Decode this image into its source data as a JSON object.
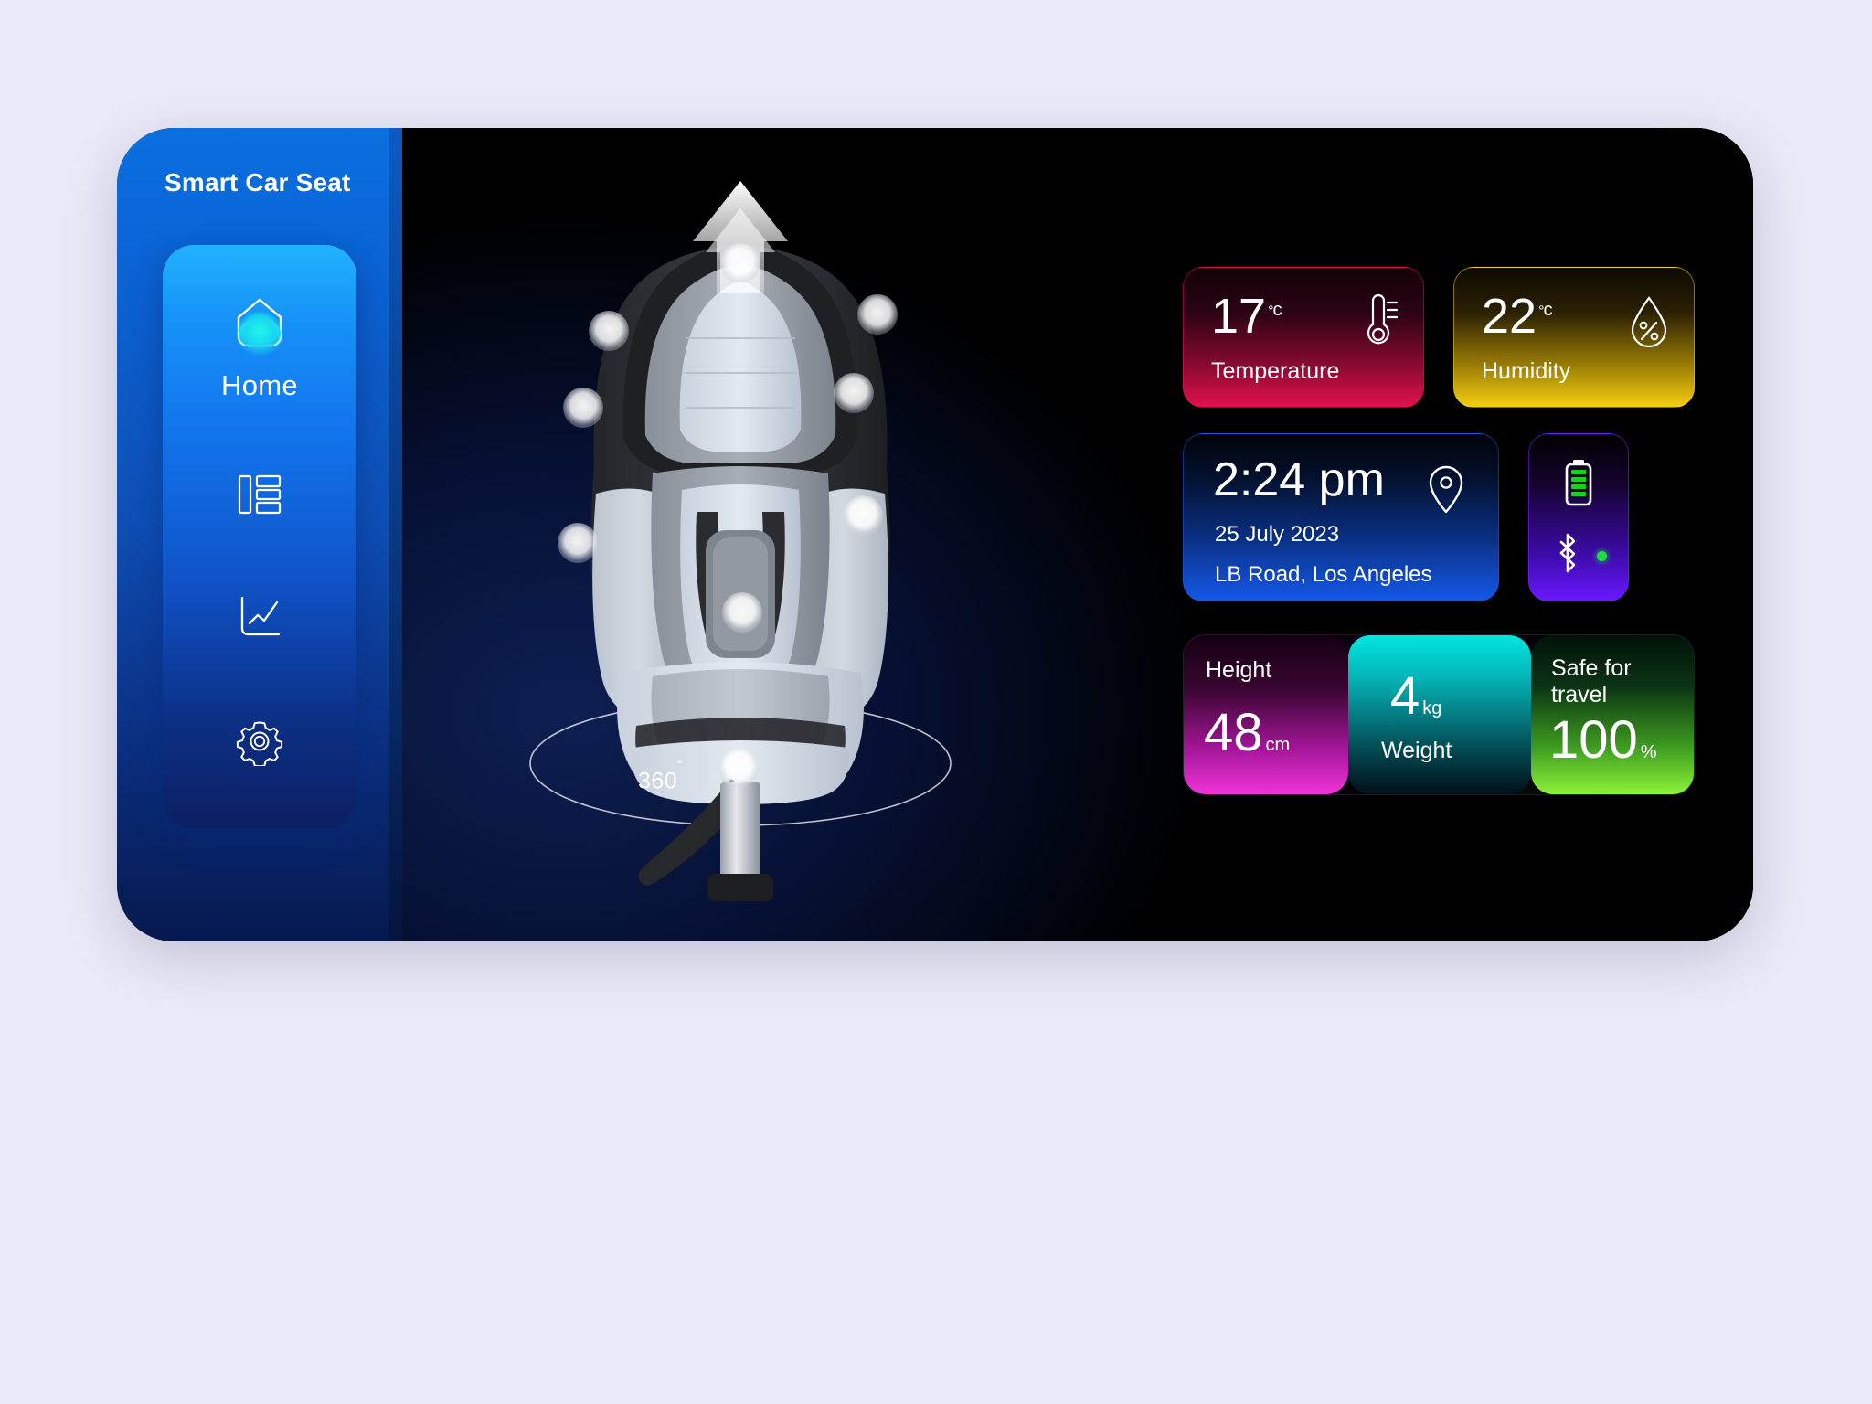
{
  "app": {
    "title": "Smart Car Seat"
  },
  "sidebar": {
    "items": [
      {
        "id": "home",
        "label": "Home",
        "icon": "home-icon",
        "active": true
      },
      {
        "id": "dashboard",
        "label": "",
        "icon": "dashboard-icon",
        "active": false
      },
      {
        "id": "stats",
        "label": "",
        "icon": "line-chart-icon",
        "active": false
      },
      {
        "id": "settings",
        "label": "",
        "icon": "gear-icon",
        "active": false
      }
    ]
  },
  "stage": {
    "rotation_label": "360",
    "rotation_degree_symbol": "°",
    "product": "child car seat",
    "hotspot_count": 6
  },
  "cards": {
    "temperature": {
      "value": "17",
      "degree": "°",
      "unit": "c",
      "label": "Temperature",
      "icon": "thermometer-icon",
      "accent": "#e2114f"
    },
    "humidity": {
      "value": "22",
      "degree": "°",
      "unit": "c",
      "label": "Humidity",
      "icon": "water-drop-percent-icon",
      "accent": "#f4cf10"
    },
    "time": {
      "time": "2:24 pm",
      "date": "25 July 2023",
      "address": "LB Road, Los Angeles",
      "icon": "location-pin-icon",
      "accent": "#1358e8"
    },
    "power": {
      "battery_icon": "battery-icon",
      "battery_bars": 4,
      "bluetooth_icon": "bluetooth-icon",
      "bluetooth_status_color": "#1ddf3a",
      "accent": "#6a18ff"
    },
    "metrics": [
      {
        "id": "height",
        "caption": "Height",
        "value": "48",
        "unit": "cm",
        "accent": "#f033d8"
      },
      {
        "id": "weight",
        "caption": "Weight",
        "value": "4",
        "unit": "kg",
        "accent": "#00e5e0"
      },
      {
        "id": "safe",
        "caption": "Safe for travel",
        "value": "100",
        "unit": "%",
        "accent": "#8ef23a"
      }
    ]
  }
}
